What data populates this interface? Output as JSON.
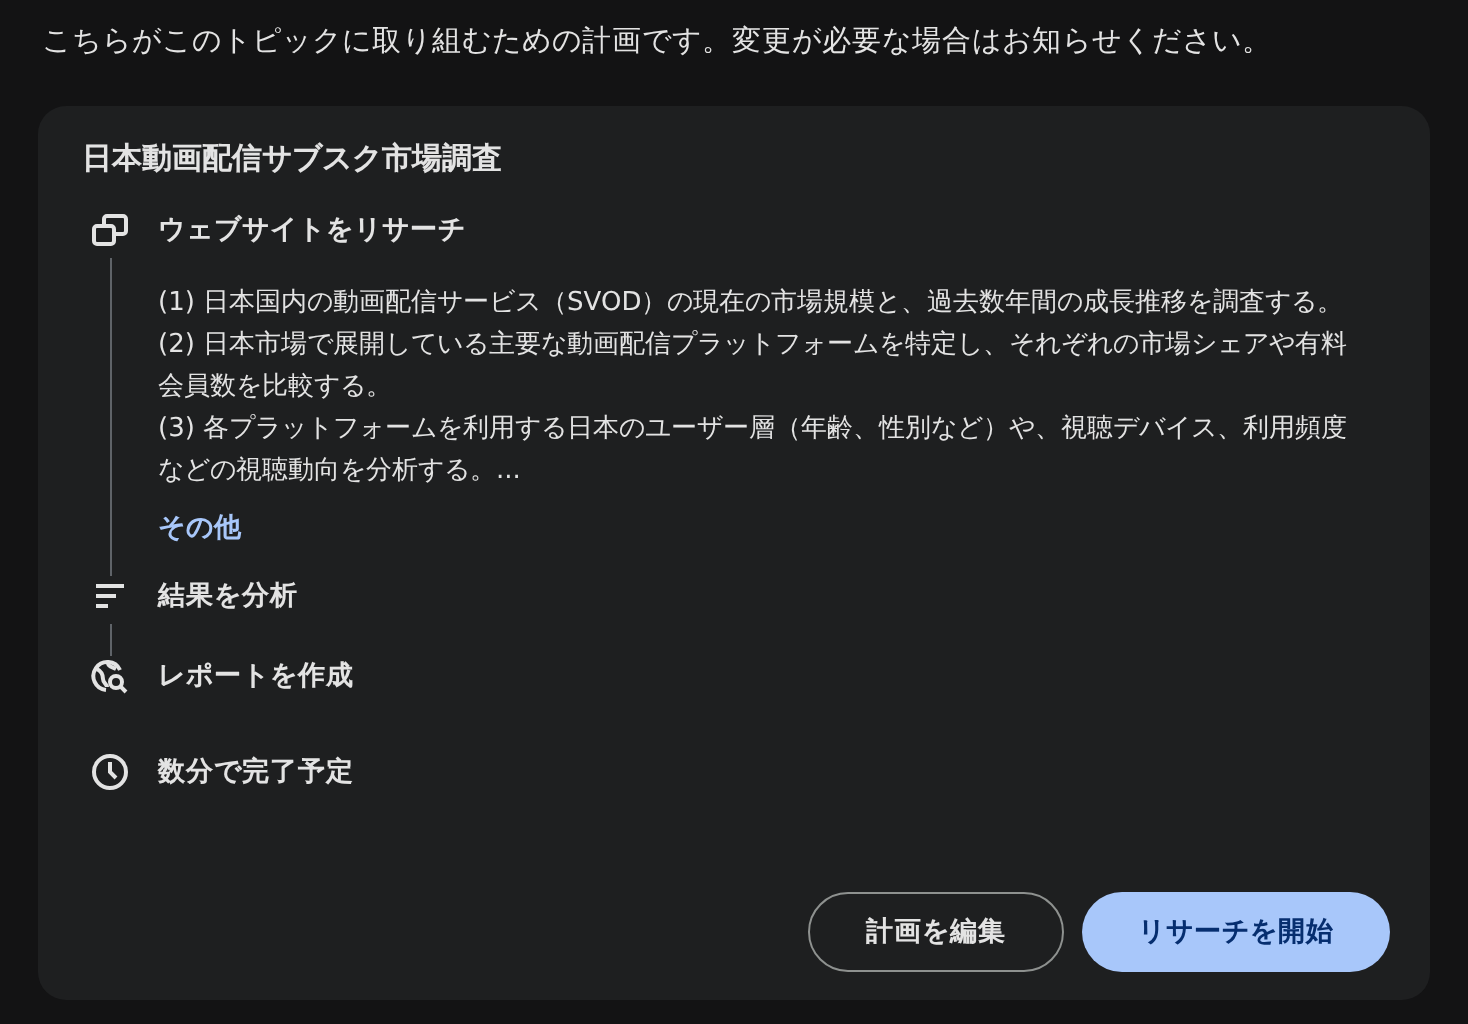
{
  "message": "こちらがこのトピックに取り組むための計画です。変更が必要な場合はお知らせください。",
  "plan": {
    "title": "日本動画配信サブスク市場調査",
    "steps": [
      {
        "kind": "research",
        "label": "ウェブサイトをリサーチ",
        "expanded": true,
        "details": [
          "(1) 日本国内の動画配信サービス（SVOD）の現在の市場規模と、過去数年間の成長推移を調査する。",
          "(2) 日本市場で展開している主要な動画配信プラットフォームを特定し、それぞれの市場シェアや有料会員数を比較する。",
          "(3) 各プラットフォームを利用する日本のユーザー層（年齢、性別など）や、視聴デバイス、利用頻度などの視聴動向を分析する。..."
        ],
        "more": "その他"
      },
      {
        "kind": "analyze",
        "label": "結果を分析",
        "expanded": false
      },
      {
        "kind": "report",
        "label": "レポートを作成",
        "expanded": false
      }
    ],
    "eta": "数分で完了予定",
    "buttons": [
      {
        "kind": "secondary",
        "label": "計画を編集"
      },
      {
        "kind": "primary",
        "label": "リサーチを開始"
      }
    ]
  }
}
